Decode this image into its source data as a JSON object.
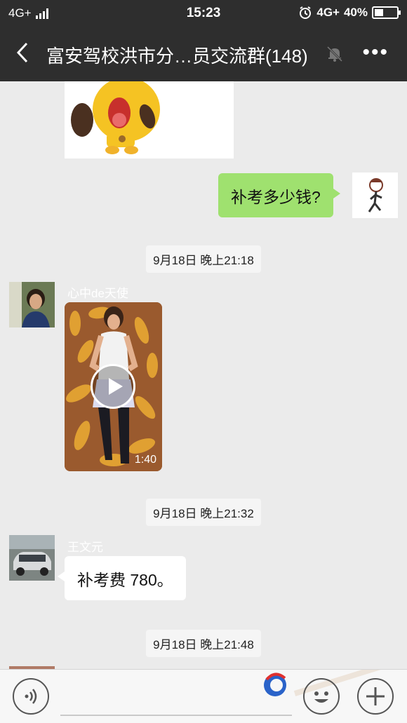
{
  "status": {
    "network_left": "4G+",
    "time": "15:23",
    "network_right": "4G+",
    "battery": "40%",
    "battery_level": 0.4
  },
  "header": {
    "title": "富安驾校洪市分…员交流群(148)"
  },
  "messages": {
    "outgoing_text": "补考多少钱?",
    "time1": "9月18日 晚上21:18",
    "sender1": "心中de天使",
    "video_duration": "1:40",
    "time2": "9月18日 晚上21:32",
    "sender2": "王文元",
    "incoming_text": "补考费 780。",
    "time3": "9月18日 晚上21:48"
  },
  "icons": {
    "back": "back-arrow-icon",
    "mute": "mute-bell-icon",
    "more": "more-icon",
    "voice": "voice-icon",
    "emoji": "emoji-icon",
    "add": "add-icon"
  },
  "colors": {
    "bar": "#2e2e2e",
    "outgoing_bubble": "#9fe16f",
    "chat_bg": "#ebebeb"
  }
}
